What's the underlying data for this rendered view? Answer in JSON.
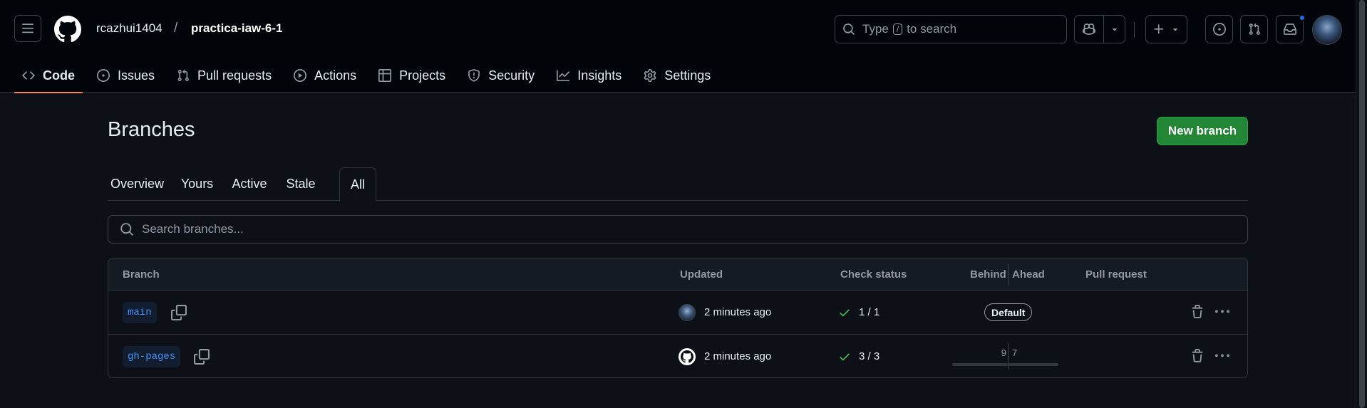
{
  "header": {
    "owner": "rcazhui1404",
    "separator": "/",
    "repo": "practica-iaw-6-1",
    "search_prefix": "Type",
    "search_key": "/",
    "search_suffix": "to search"
  },
  "repo_nav": [
    {
      "label": "Code",
      "icon": "code-icon",
      "selected": true
    },
    {
      "label": "Issues",
      "icon": "issue-icon"
    },
    {
      "label": "Pull requests",
      "icon": "pull-request-icon"
    },
    {
      "label": "Actions",
      "icon": "play-icon"
    },
    {
      "label": "Projects",
      "icon": "table-icon"
    },
    {
      "label": "Security",
      "icon": "shield-icon"
    },
    {
      "label": "Insights",
      "icon": "graph-icon"
    },
    {
      "label": "Settings",
      "icon": "gear-icon"
    }
  ],
  "page": {
    "title": "Branches",
    "new_branch_label": "New branch",
    "search_placeholder": "Search branches..."
  },
  "tabs": [
    {
      "label": "Overview"
    },
    {
      "label": "Yours"
    },
    {
      "label": "Active"
    },
    {
      "label": "Stale"
    },
    {
      "label": "All",
      "selected": true
    }
  ],
  "table": {
    "headers": {
      "branch": "Branch",
      "updated": "Updated",
      "check_status": "Check status",
      "behind": "Behind",
      "ahead": "Ahead",
      "pull_request": "Pull request"
    },
    "rows": [
      {
        "name": "main",
        "updated": "2 minutes ago",
        "checks": "1 / 1",
        "badge": "Default",
        "avatar": "user-avatar"
      },
      {
        "name": "gh-pages",
        "updated": "2 minutes ago",
        "checks": "3 / 3",
        "behind": "9",
        "ahead": "7",
        "avatar": "github-avatar"
      }
    ]
  },
  "colors": {
    "accent_green": "#238636",
    "link_blue": "#4493f8",
    "check_green": "#3fb950",
    "nav_underline": "#f78166"
  }
}
